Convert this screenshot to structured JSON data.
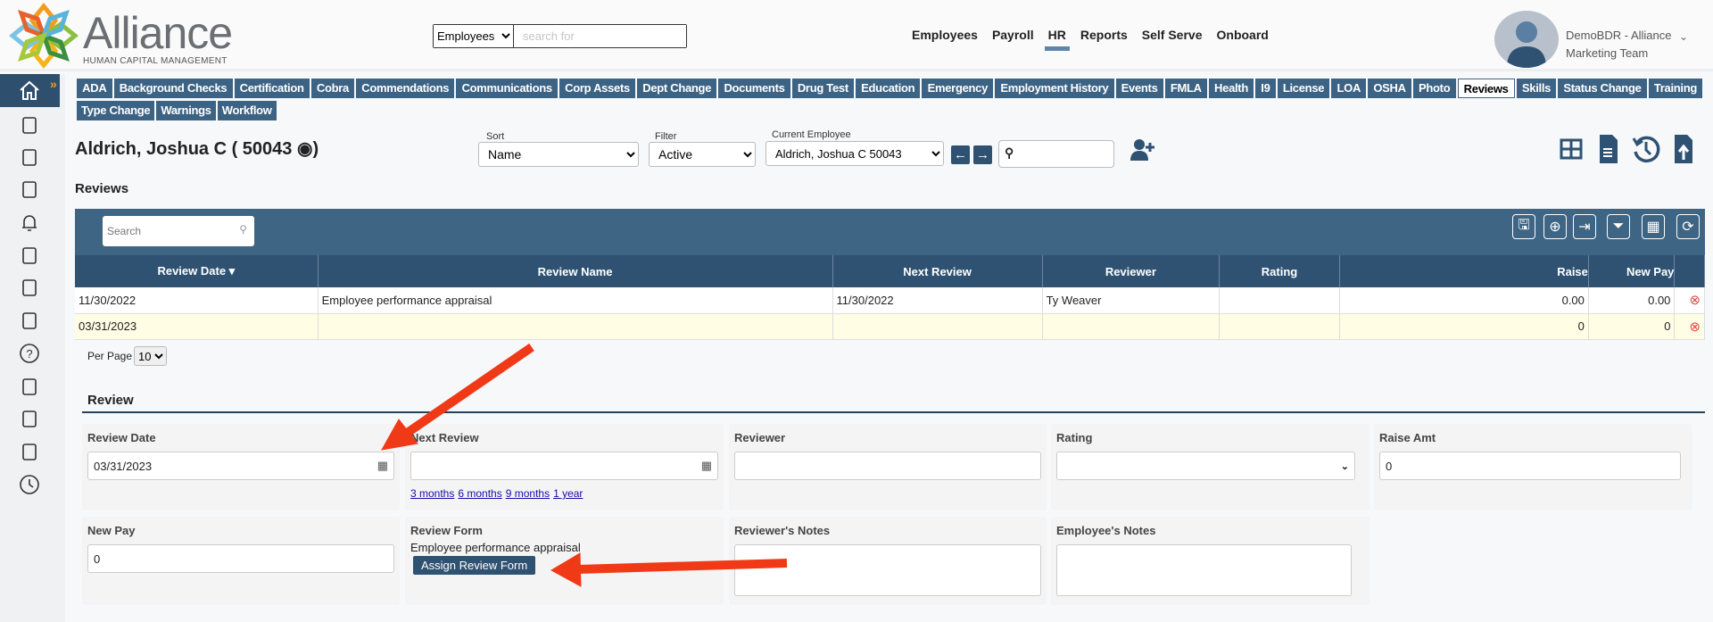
{
  "brand": {
    "name": "Alliance",
    "tagline": "HUMAN CAPITAL MANAGEMENT"
  },
  "global_search": {
    "scope": "Employees",
    "placeholder": "search for"
  },
  "topnav": [
    "Employees",
    "Payroll",
    "HR",
    "Reports",
    "Self Serve",
    "Onboard"
  ],
  "topnav_active": "HR",
  "user": {
    "line1": "DemoBDR - Alliance",
    "line2": "Marketing Team"
  },
  "sidebar_icons": [
    "home-icon",
    "analytics-icon",
    "briefcase-icon",
    "building-icon",
    "bell-icon",
    "basket-icon",
    "graduation-cap-icon",
    "lightbulb-icon",
    "help-icon",
    "headset-icon",
    "person-icon",
    "monitor-icon",
    "clock-icon"
  ],
  "tabs": {
    "row1": [
      "ADA",
      "Background Checks",
      "Certification",
      "Cobra",
      "Commendations",
      "Communications",
      "Corp Assets",
      "Dept Change",
      "Documents",
      "Drug Test",
      "Education",
      "Emergency",
      "Employment History",
      "Events",
      "FMLA",
      "Health",
      "I9",
      "License",
      "LOA",
      "OSHA",
      "Photo",
      "Reviews",
      "Skills",
      "Status Change",
      "Training"
    ],
    "row2": [
      "Type Change",
      "Warnings",
      "Workflow"
    ],
    "active": "Reviews"
  },
  "employee": {
    "name": "Aldrich, Joshua C ( 50043",
    "close": ")"
  },
  "controls": {
    "sort_label": "Sort",
    "sort_value": "Name",
    "filter_label": "Filter",
    "filter_value": "Active",
    "current_label": "Current Employee",
    "current_value": "Aldrich, Joshua C 50043"
  },
  "section_title": "Reviews",
  "grid": {
    "search_placeholder": "Search",
    "columns": [
      "Review Date ▾",
      "Review Name",
      "Next Review",
      "Reviewer",
      "Rating",
      "Raise",
      "New Pay",
      ""
    ],
    "rows": [
      [
        "11/30/2022",
        "Employee performance appraisal",
        "11/30/2022",
        "Ty Weaver",
        "",
        "0.00",
        "0.00"
      ],
      [
        "03/31/2023",
        "",
        "",
        "",
        "",
        "0",
        "0"
      ]
    ],
    "per_page_label": "Per Page",
    "per_page": "10"
  },
  "form": {
    "title": "Review",
    "review_date_label": "Review Date",
    "review_date": "03/31/2023",
    "next_review_label": "Next Review",
    "next_review": "",
    "quick_links": [
      "3 months",
      "6 months",
      "9 months",
      "1 year"
    ],
    "reviewer_label": "Reviewer",
    "rating_label": "Rating",
    "raise_label": "Raise Amt",
    "raise": "0",
    "new_pay_label": "New Pay",
    "new_pay": "0",
    "review_form_label": "Review Form",
    "review_form_value": "Employee performance appraisal",
    "assign_button": "Assign Review Form",
    "reviewer_notes_label": "Reviewer's Notes",
    "employee_notes_label": "Employee's Notes"
  },
  "colors": {
    "primary": "#2f5272",
    "tab": "#3d6384",
    "annotation_arrow": "#f03a17",
    "selected_row": "#fffde3"
  }
}
